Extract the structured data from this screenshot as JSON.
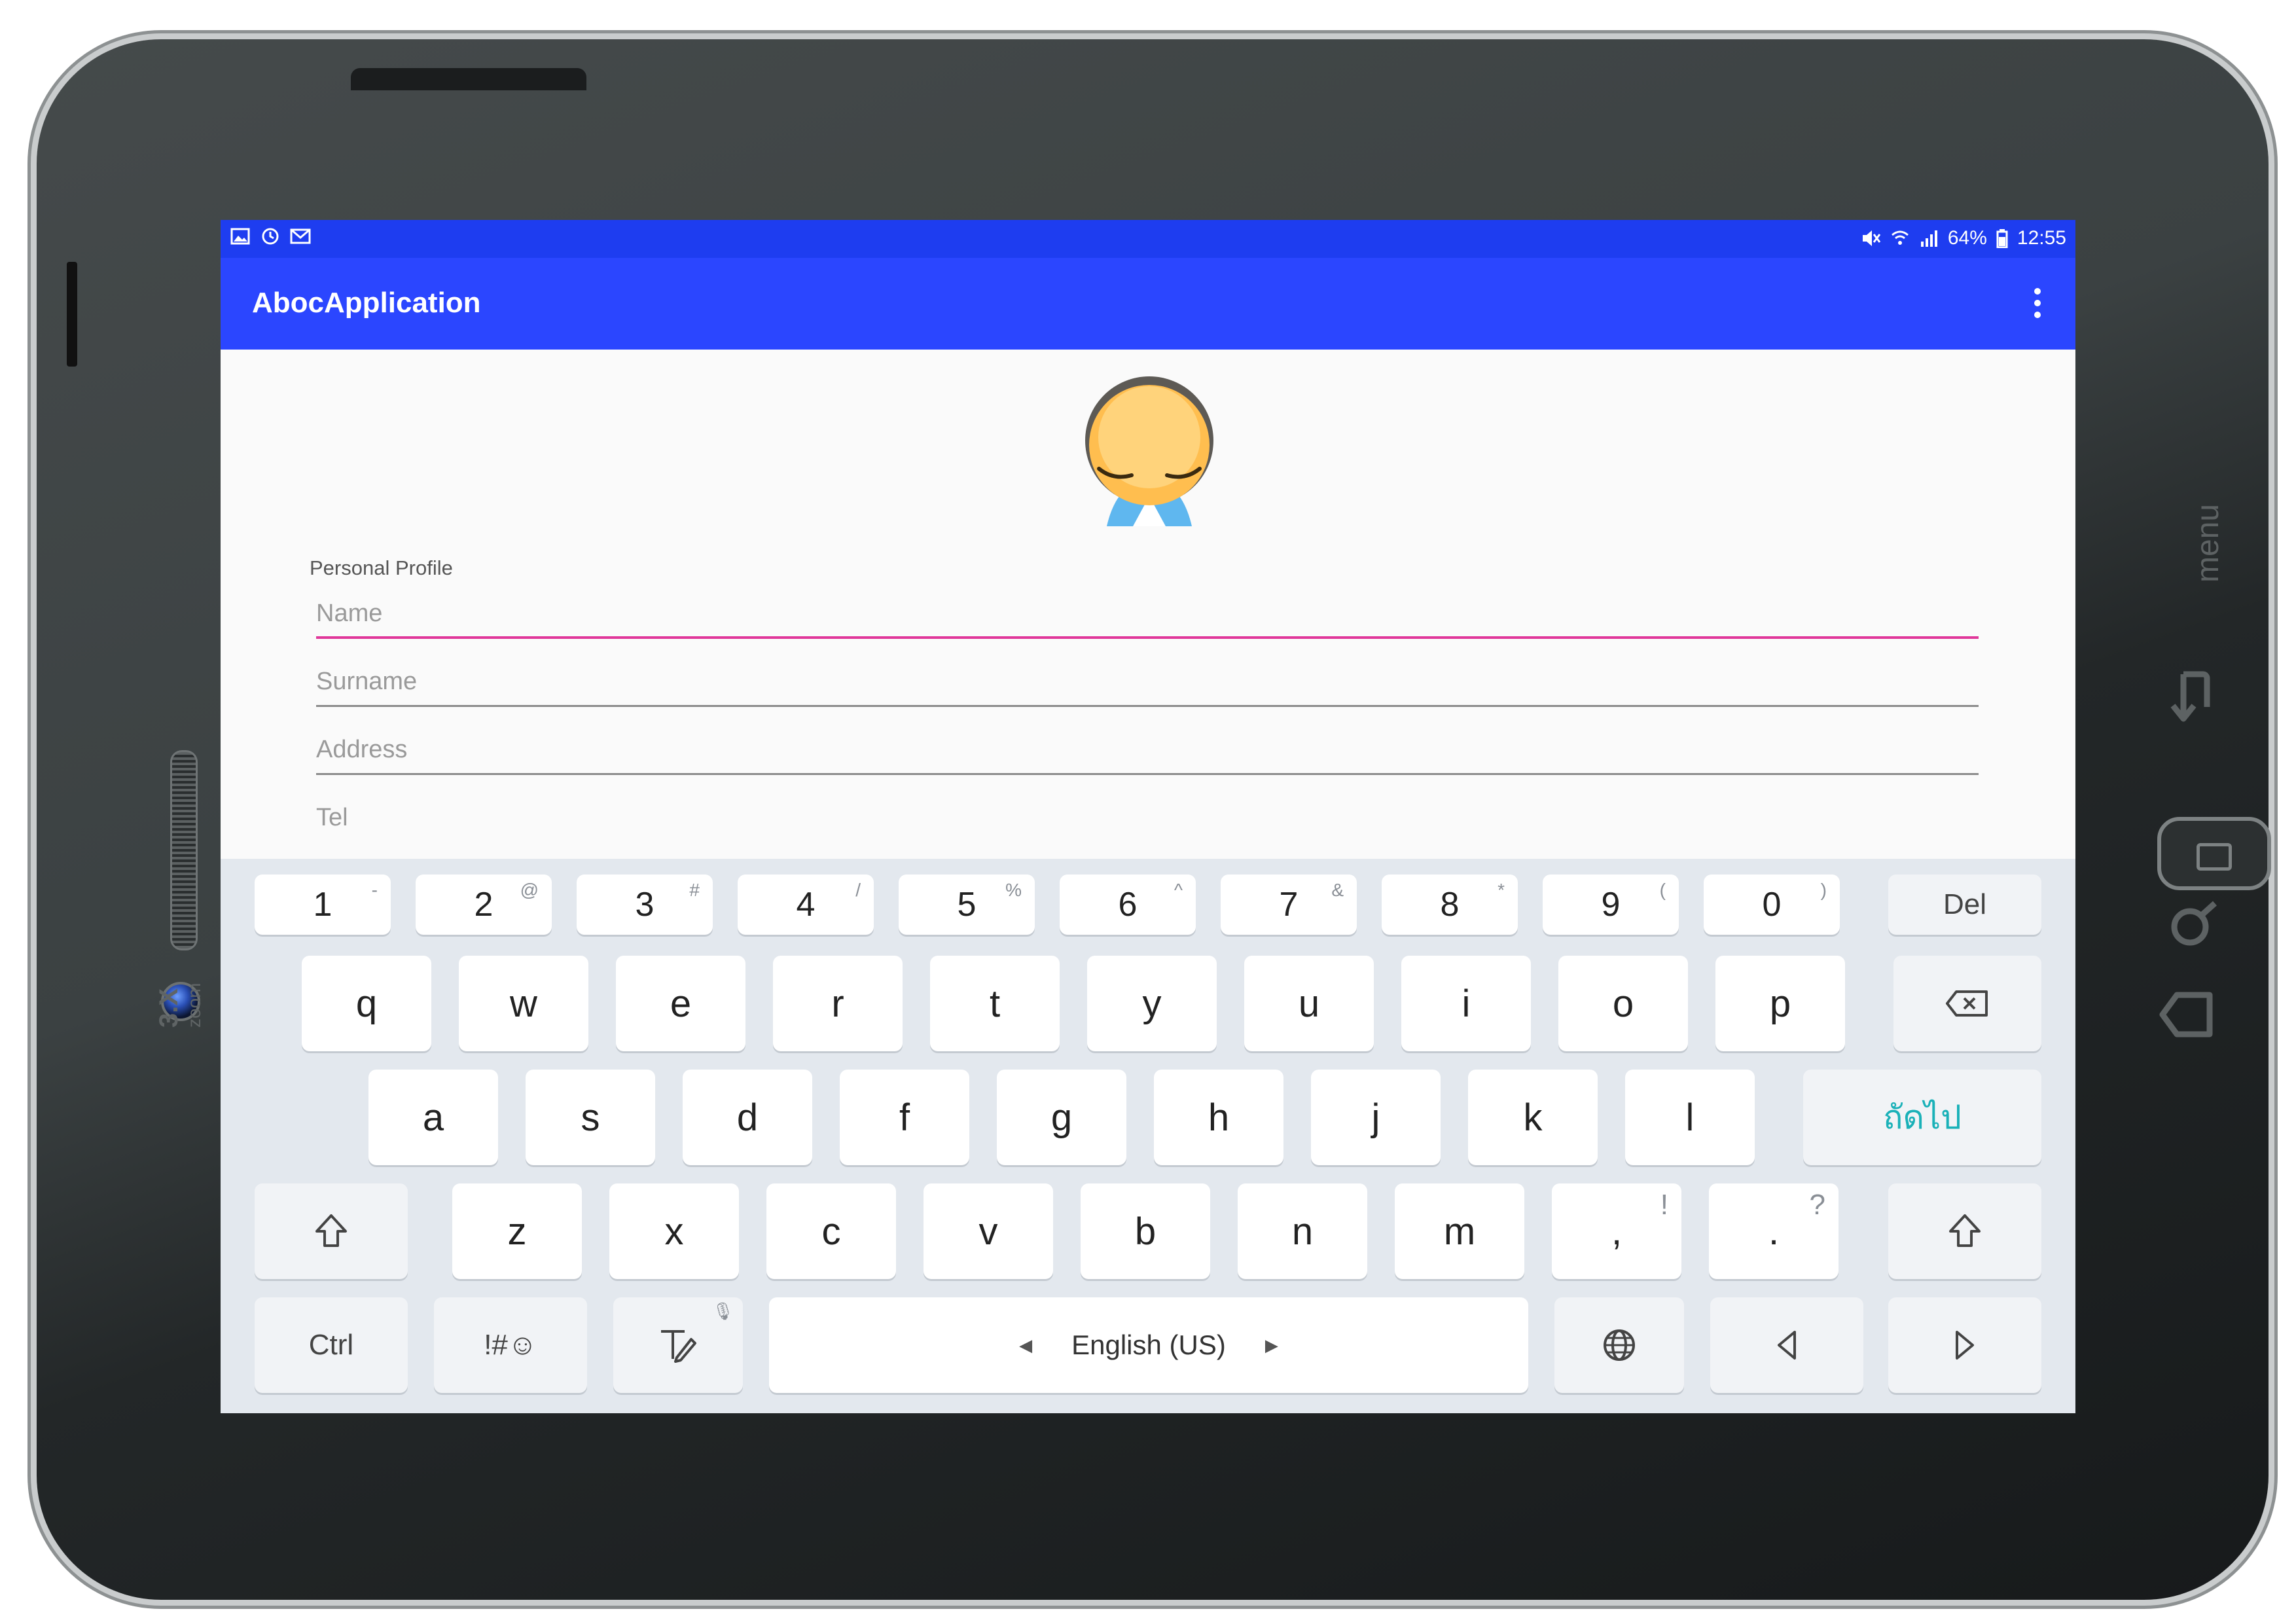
{
  "device": {
    "brand_text": "3.X",
    "zoom_text": "zoom",
    "menu_label": "menu"
  },
  "status_bar": {
    "left_icons": [
      "gallery-icon",
      "sync-icon",
      "mail-icon"
    ],
    "right_icons": [
      "mute-icon",
      "wifi-icon",
      "signal-icon"
    ],
    "battery": "64%",
    "time": "12:55"
  },
  "app_bar": {
    "title": "AbocApplication",
    "overflow_icon": "more-vert-icon"
  },
  "form": {
    "section_label": "Personal Profile",
    "fields": [
      {
        "placeholder": "Name",
        "value": ""
      },
      {
        "placeholder": "Surname",
        "value": ""
      },
      {
        "placeholder": "Address",
        "value": ""
      },
      {
        "placeholder": "Tel",
        "value": ""
      }
    ]
  },
  "keyboard": {
    "number_row": [
      {
        "key": "1",
        "sub": "-"
      },
      {
        "key": "2",
        "sub": "@"
      },
      {
        "key": "3",
        "sub": "#"
      },
      {
        "key": "4",
        "sub": "/"
      },
      {
        "key": "5",
        "sub": "%"
      },
      {
        "key": "6",
        "sub": "^"
      },
      {
        "key": "7",
        "sub": "&"
      },
      {
        "key": "8",
        "sub": "*"
      },
      {
        "key": "9",
        "sub": "("
      },
      {
        "key": "0",
        "sub": ")"
      }
    ],
    "del_label": "Del",
    "row1": [
      "q",
      "w",
      "e",
      "r",
      "t",
      "y",
      "u",
      "i",
      "o",
      "p"
    ],
    "row2": [
      "a",
      "s",
      "d",
      "f",
      "g",
      "h",
      "j",
      "k",
      "l"
    ],
    "next_label": "ถัดไป",
    "row3": [
      "z",
      "x",
      "c",
      "v",
      "b",
      "n",
      "m"
    ],
    "comma": {
      "key": ",",
      "sub": "!"
    },
    "period": {
      "key": ".",
      "sub": "?"
    },
    "ctrl_label": "Ctrl",
    "symbols_label": "!#☺",
    "space_label": "English (US)",
    "accent_color": "#2b46ff",
    "status_color": "#1e3df0",
    "focus_color": "#e0379a"
  }
}
